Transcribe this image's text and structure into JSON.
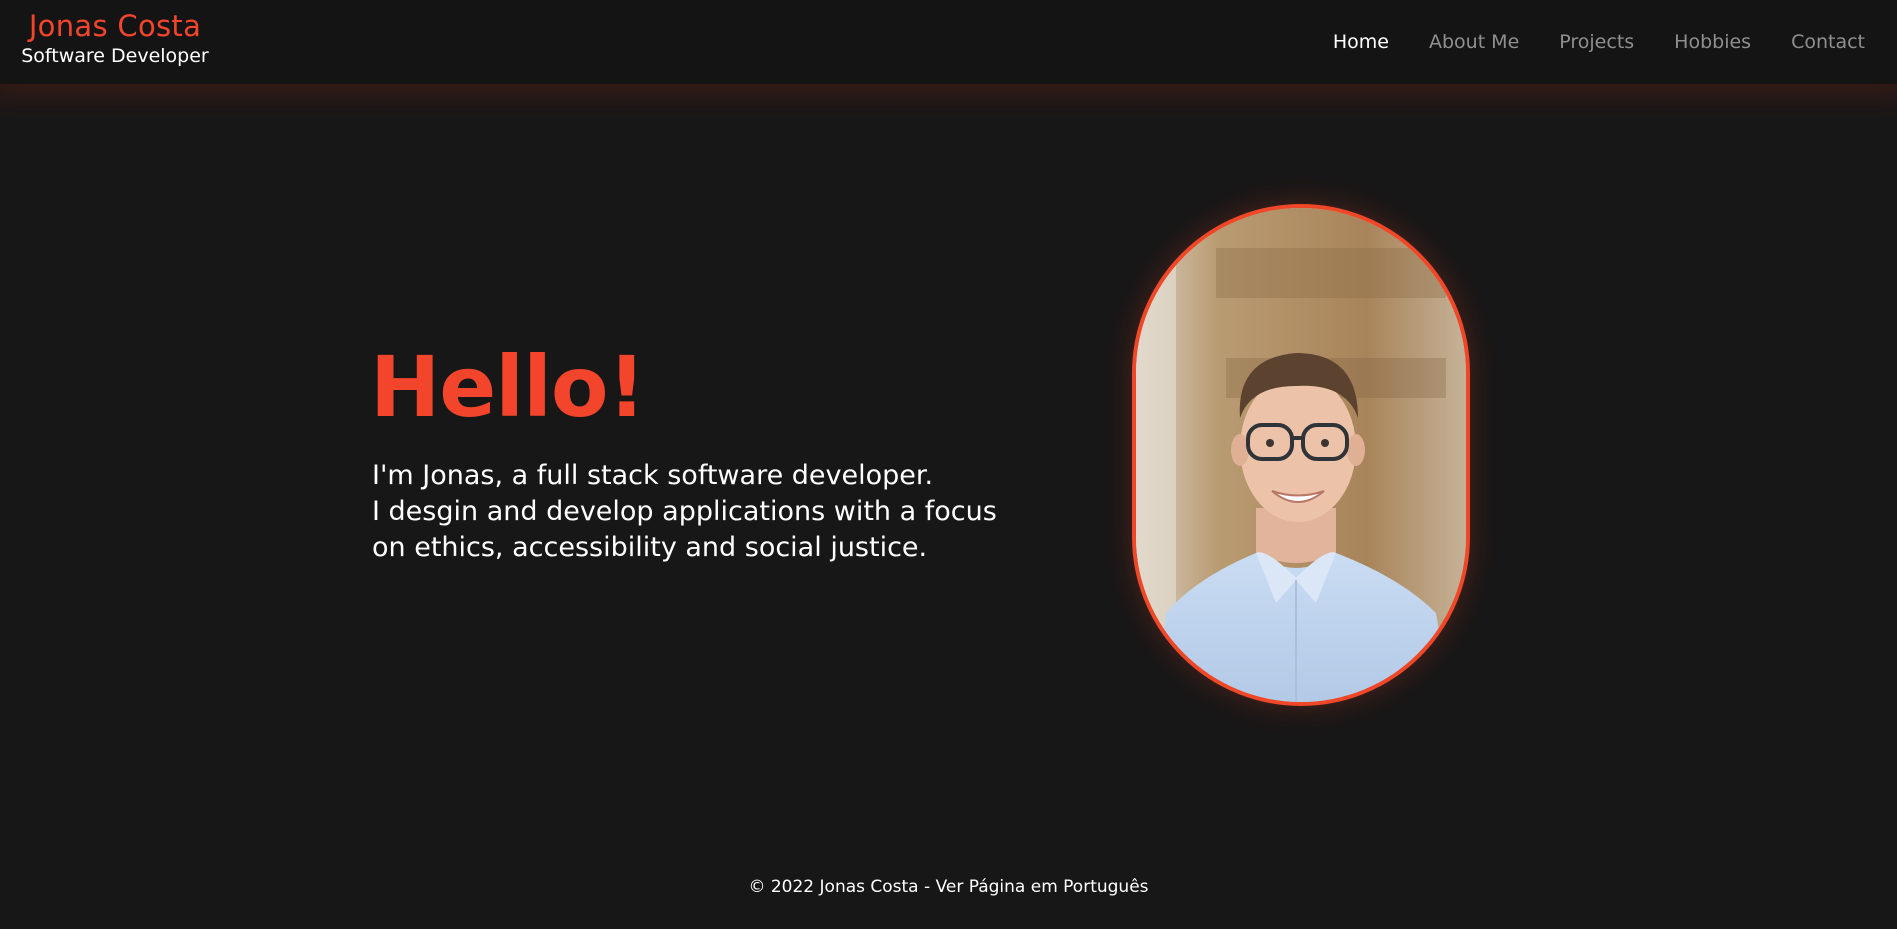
{
  "header": {
    "brand_name": "Jonas Costa",
    "brand_role": "Software Developer",
    "nav": [
      {
        "label": "Home"
      },
      {
        "label": "About Me"
      },
      {
        "label": "Projects"
      },
      {
        "label": "Hobbies"
      },
      {
        "label": "Contact"
      }
    ],
    "active_nav": "Home"
  },
  "hero": {
    "title": "Hello!",
    "lines": [
      "I'm Jonas, a full stack software developer.",
      "I desgin and develop applications with a focus",
      "on ethics, accessibility and social justice."
    ],
    "portrait_icon": "portrait-photo"
  },
  "footer": {
    "copyright": "© 2022 Jonas Costa",
    "separator": " - ",
    "language_link": "Ver Página em Português"
  },
  "colors": {
    "accent": "#f2452b",
    "background": "#181717",
    "nav_inactive": "#8f8f8f",
    "text": "#ffffff"
  }
}
